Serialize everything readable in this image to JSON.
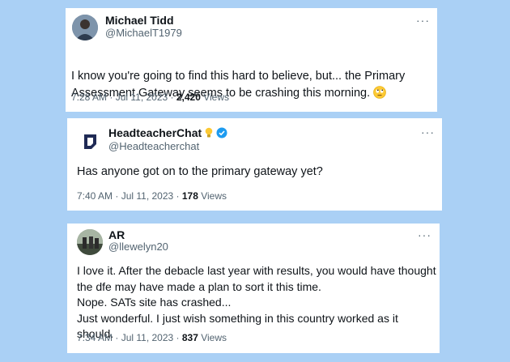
{
  "tweets": [
    {
      "name": "Michael Tidd",
      "handle": "@MichaelT1979",
      "more": "···",
      "text": "I know you're going to find this hard to believe, but... the Primary Assessment Gateway seems to be crashing this morning.",
      "emoji": "rolling-eyes-emoji",
      "time": "7:28 AM · Jul 11, 2023 · ",
      "views_count": "2,420",
      "views_label": " Views"
    },
    {
      "name": "HeadteacherChat",
      "handle": "@Headteacherchat",
      "more": "···",
      "text": "Has anyone got on to the primary gateway yet?",
      "time": "7:40 AM · Jul 11, 2023 · ",
      "views_count": "178",
      "views_label": " Views"
    },
    {
      "name": "AR",
      "handle": "@llewelyn20",
      "more": "···",
      "text": "I love it. After the debacle last year with results, you would have thought\nthe dfe may have made a plan to sort it this time.\nNope. SATs site has crashed...\nJust wonderful. I just wish something in this country worked as it should.",
      "time": "7:34 AM · Jul 11, 2023 · ",
      "views_count": "837",
      "views_label": " Views"
    }
  ],
  "colors": {
    "background": "#aad0f5",
    "card": "#ffffff",
    "verified": "#1d9bf0",
    "secondary_text": "#536471"
  }
}
